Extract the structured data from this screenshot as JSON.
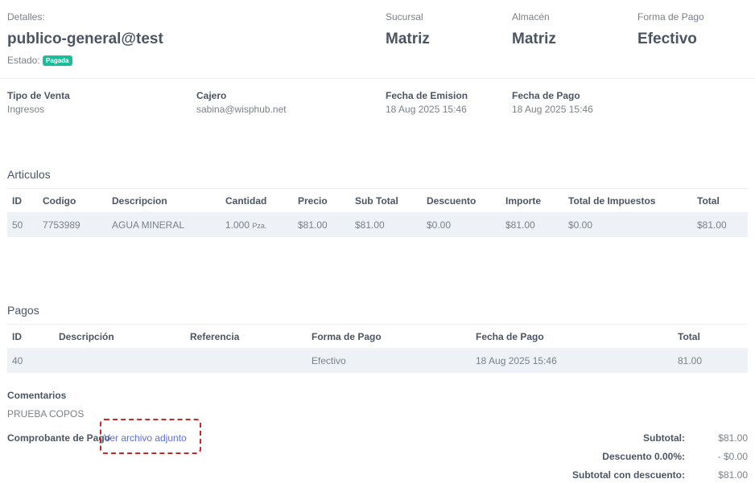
{
  "header": {
    "details_label": "Detalles:",
    "client": "publico-general@test",
    "status_label": "Estado:",
    "status_badge": "Pagada",
    "sucursal_label": "Sucursal",
    "sucursal": "Matriz",
    "almacen_label": "Almacén",
    "almacen": "Matriz",
    "forma_pago_label": "Forma de Pago",
    "forma_pago": "Efectivo"
  },
  "info": {
    "tipo_venta_label": "Tipo de Venta",
    "tipo_venta": "Ingresos",
    "cajero_label": "Cajero",
    "cajero": "sabina@wisphub.net",
    "fecha_emision_label": "Fecha de Emision",
    "fecha_emision": "18 Aug 2025 15:46",
    "fecha_pago_label": "Fecha de Pago",
    "fecha_pago": "18 Aug 2025 15:46"
  },
  "articulos": {
    "title": "Articulos",
    "headers": [
      "ID",
      "Codigo",
      "Descripcion",
      "Cantidad",
      "Precio",
      "Sub Total",
      "Descuento",
      "Importe",
      "Total de Impuestos",
      "Total"
    ],
    "rows": [
      {
        "id": "50",
        "codigo": "7753989",
        "descripcion": "AGUA MINERAL",
        "cantidad": "1.000",
        "unidad": "Pza.",
        "precio": "$81.00",
        "subtotal": "$81.00",
        "descuento": "$0.00",
        "importe": "$81.00",
        "impuestos": "$0.00",
        "total": "$81.00"
      }
    ]
  },
  "pagos": {
    "title": "Pagos",
    "headers": [
      "ID",
      "Descripción",
      "Referencia",
      "Forma de Pago",
      "Fecha de Pago",
      "Total"
    ],
    "rows": [
      {
        "id": "40",
        "descripcion": "",
        "referencia": "",
        "forma_pago": "Efectivo",
        "fecha_pago": "18 Aug 2025 15:46",
        "total": "81.00"
      }
    ]
  },
  "comentarios": {
    "label": "Comentarios",
    "text": "PRUEBA COPOS"
  },
  "comprobante": {
    "label": "Comprobante de Pago",
    "link": "Ver archivo adjunto"
  },
  "totals": {
    "subtotal_label": "Subtotal:",
    "subtotal": "$81.00",
    "descuento_label": "Descuento 0.00%:",
    "descuento": "- $0.00",
    "subtotal_desc_label": "Subtotal con descuento:",
    "subtotal_desc": "$81.00"
  },
  "colors": {
    "badge": "#1abc9c",
    "link": "#5b6ee1",
    "highlight": "#c62828",
    "row_bg": "#eef2f7"
  }
}
